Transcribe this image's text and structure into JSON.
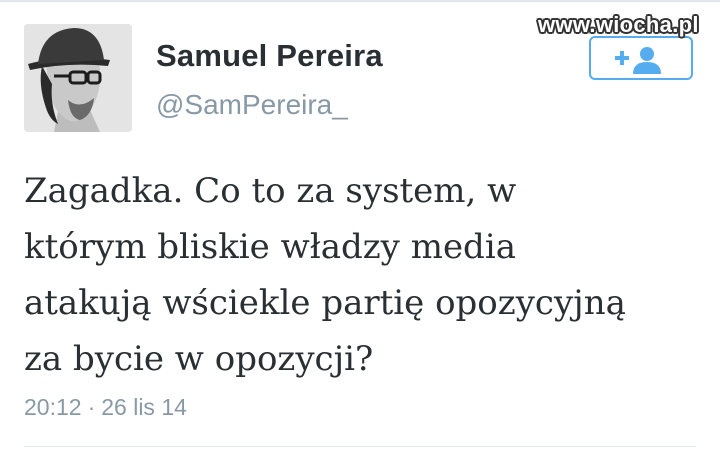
{
  "watermark": "www.wiocha.pl",
  "tweet": {
    "author": {
      "display_name": "Samuel Pereira",
      "screen_name": "@SamPereira_",
      "avatar_icon": "user-avatar-photo"
    },
    "follow_button": {
      "icon": "follow-user-icon",
      "color": "#55acee"
    },
    "text_lines": [
      "Zagadka. Co to za system, w",
      "którym bliskie władzy media",
      "atakują wściekle partię opozycyjną",
      "za bycie w opozycji?"
    ],
    "time": "20:12",
    "separator": "·",
    "date": "26 lis 14"
  },
  "colors": {
    "text": "#292f33",
    "muted": "#8899a6",
    "accent": "#55acee",
    "divider": "#e1e8ed"
  }
}
